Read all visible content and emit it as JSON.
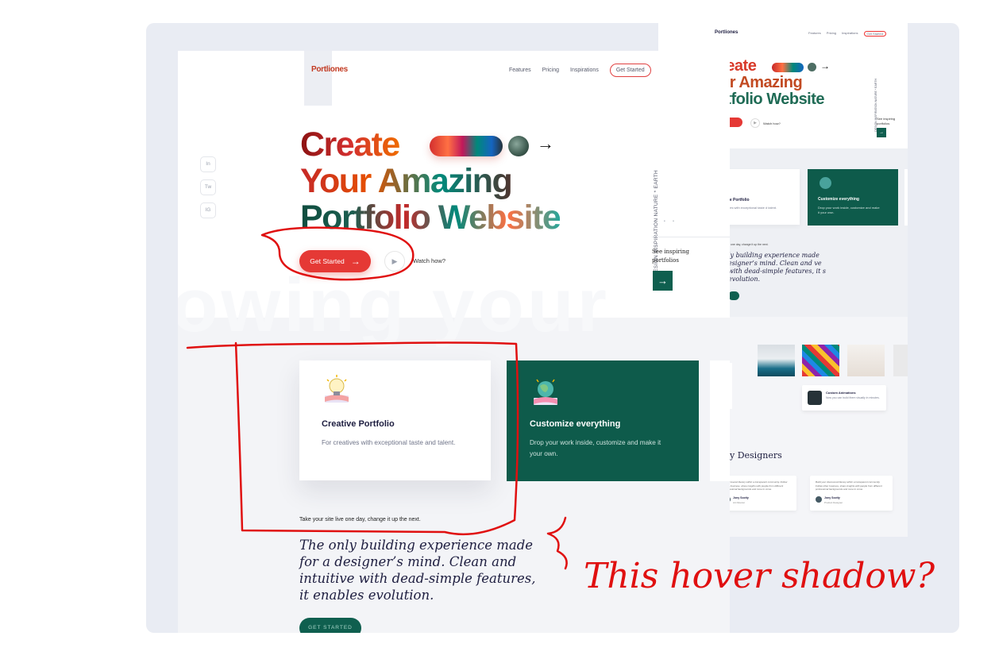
{
  "main": {
    "logo": "Portliones",
    "nav": [
      "Features",
      "Pricing",
      "Inspirations"
    ],
    "nav_cta": "Get Started",
    "social": [
      "In",
      "Tw",
      "IG"
    ],
    "headline": [
      "Create",
      "Your Amazing",
      "Portfolio Website"
    ],
    "arrow": "→",
    "vertical_text": "DESIGN INSPIRATION NATURE * EARTH",
    "vertical_dots": "• •",
    "see_inspiring": "See inspiring portfolios",
    "see_arrow": "→",
    "watermark": "owing your",
    "get_started": "Get Started",
    "get_started_arrow": "→",
    "play_icon": "▶",
    "watch": "Watch how?",
    "cards": [
      {
        "title": "Creative Portfolio",
        "desc": "For creatives with exceptional taste and talent."
      },
      {
        "title": "Customize everything",
        "desc": "Drop your work inside, customize and make it your own."
      }
    ],
    "take_line": "Take your site live one day, change it up the next.",
    "quote": "The only building experience made for a designer’s mind. Clean and intuitive with dead-simple features, it enables evolution.",
    "bottom_cta": "GET STARTED"
  },
  "secondary": {
    "logo": "Portliones",
    "nav": [
      "Features",
      "Pricing",
      "Inspirations",
      "Get Started"
    ],
    "headline": [
      "reate",
      "ur Amazing",
      "rtfolio Website"
    ],
    "arrow": "→",
    "vertical_text": "DESIGN INSPIRATION NATURE * EARTH",
    "watch": "Watch how?",
    "play_icon": "▶",
    "see_inspiring": "See inspiring portfolios",
    "see_arrow": "→",
    "card1_title": "tive Portfolio",
    "card1_desc": "atives with exceptional taste d talent.",
    "card2_title": "Customize everything",
    "card2_desc": "Drop your work inside, customize and make it your own.",
    "take_line": "e one day, change it up the next.",
    "quote": "ly building experience made esigner’s mind. Clean and ve with dead-simple features, it s evolution.",
    "side_card_text": "ves",
    "anim_title": "Custom Animations",
    "anim_desc": "Now you can build them visually in minutes.",
    "designers": "y Designers",
    "testimonials": [
      {
        "quote": "...discovered literary within a transparent community. Follow other business, share insights with people from different professional backgrounds and more to come.",
        "name": "Jony Scotty",
        "role": "Art Director"
      },
      {
        "quote": "Build your discovered literary within a transparent community. Follow other business, share insights with people from different professional backgrounds and more to come.",
        "name": "Jony Scotty",
        "role": "Product Designer"
      }
    ]
  },
  "annotation": {
    "text": "This hover shadow?",
    "color": "#e01010"
  },
  "colors": {
    "accent_red": "#e53935",
    "brand_green": "#0e5b4b",
    "backdrop": "#e9ecf3",
    "text_dark": "#1e1e40"
  }
}
